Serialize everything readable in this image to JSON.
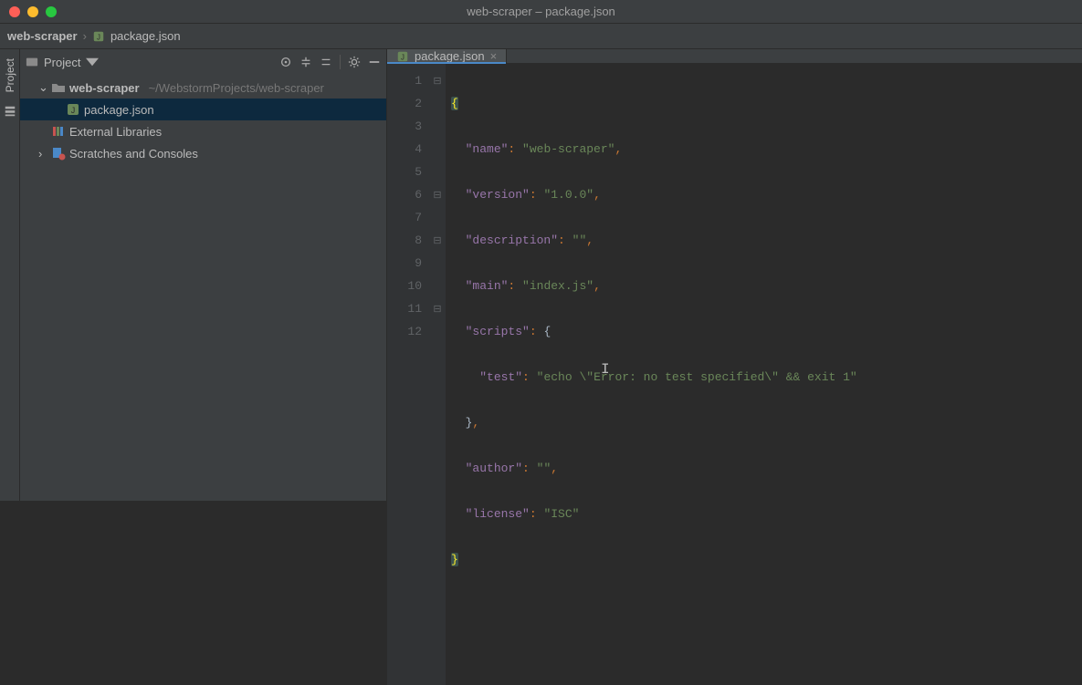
{
  "window": {
    "title": "web-scraper – package.json"
  },
  "breadcrumb": {
    "root": "web-scraper",
    "file": "package.json"
  },
  "projectPanel": {
    "title": "Project",
    "rootName": "web-scraper",
    "rootPath": "~/WebstormProjects/web-scraper",
    "items": [
      "package.json"
    ],
    "externalLibraries": "External Libraries",
    "scratches": "Scratches and Consoles"
  },
  "editor": {
    "tab": "package.json",
    "lineNumbers": [
      "1",
      "2",
      "3",
      "4",
      "5",
      "6",
      "7",
      "8",
      "9",
      "10",
      "11",
      "12"
    ],
    "code": {
      "name_k": "\"name\"",
      "name_v": "\"web-scraper\"",
      "version_k": "\"version\"",
      "version_v": "\"1.0.0\"",
      "desc_k": "\"description\"",
      "desc_v": "\"\"",
      "main_k": "\"main\"",
      "main_v": "\"index.js\"",
      "scripts_k": "\"scripts\"",
      "test_k": "\"test\"",
      "test_v": "\"echo \\\"Error: no test specified\\\" && exit 1\"",
      "author_k": "\"author\"",
      "author_v": "\"\"",
      "license_k": "\"license\"",
      "license_v": "\"ISC\""
    }
  },
  "tool": {
    "project": "Project"
  }
}
